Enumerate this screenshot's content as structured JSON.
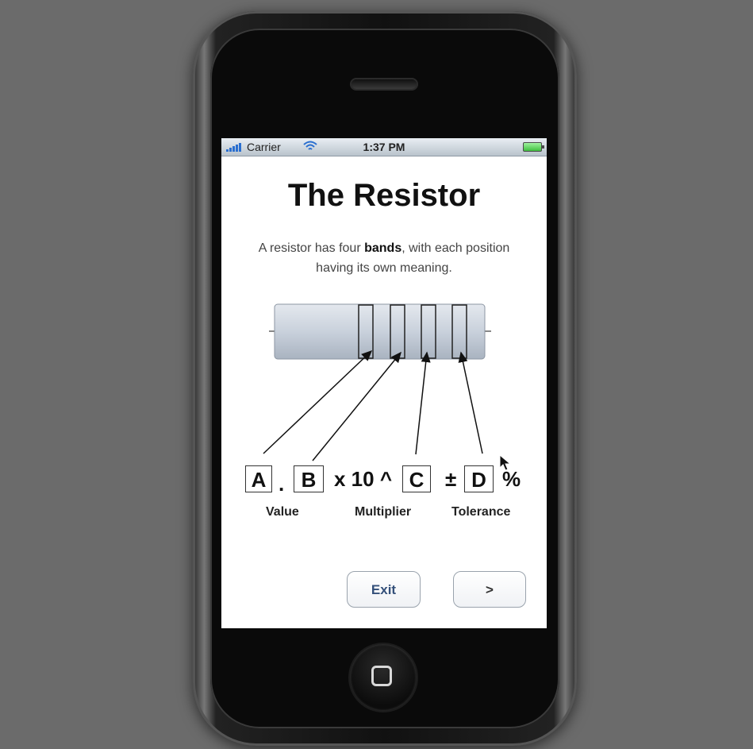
{
  "status_bar": {
    "carrier": "Carrier",
    "time": "1:37 PM"
  },
  "page": {
    "title": "The Resistor",
    "description_before": "A resistor has four ",
    "description_bold": "bands",
    "description_after": ", with each position having its own meaning."
  },
  "diagram": {
    "box_a": "A",
    "dot": ".",
    "box_b": "B",
    "multiplier_text": "x 10 ^",
    "box_c": "C",
    "plus_minus": "±",
    "box_d": "D",
    "percent": "%",
    "label_value": "Value",
    "label_multiplier": "Multiplier",
    "label_tolerance": "Tolerance"
  },
  "buttons": {
    "exit": "Exit",
    "next": ">"
  },
  "colors": {
    "background": "#6b6b6b",
    "button_text": "#34507a",
    "resistor_body": "#c9d1dc"
  },
  "icons": [
    "signal-bars-icon",
    "wifi-icon",
    "battery-icon",
    "home-button-icon",
    "mouse-cursor-icon"
  ]
}
